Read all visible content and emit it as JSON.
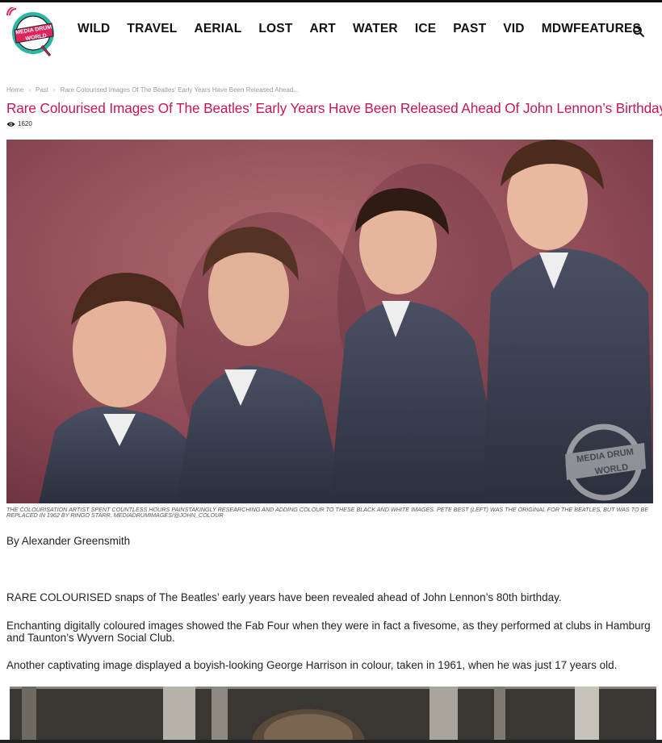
{
  "site": {
    "logo_text_line1": "MEDIA DRUM",
    "logo_text_line2": "WORLD",
    "nav": [
      "WILD",
      "TRAVEL",
      "AERIAL",
      "LOST",
      "ART",
      "WATER",
      "ICE",
      "PAST",
      "VID",
      "MDWFEATURES"
    ],
    "search_icon": "search-icon"
  },
  "breadcrumb": {
    "home": "Home",
    "section": "Past",
    "current": "Rare Colourised Images Of The Beatles' Early Years Have Been Released Ahead..."
  },
  "article": {
    "title": "Rare Colourised Images Of The Beatles’ Early Years Have Been Released Ahead Of John Lennon’s Birthday",
    "views": "1620",
    "caption": "THE COLOURISATION ARTIST SPENT COUNTLESS HOURS PAINSTAKINGLY RESEARCHING AND ADDING COLOUR TO THESE BLACK AND WHITE IMAGES. PETE BEST (LEFT) WAS THE ORIGINAL FOR THE BEATLES, BUT WAS TO BE REPLACED IN 1962 BY RINGO STARR. MEDIADRUMIMAGES/@JOHN_COLOUR",
    "watermark_line1": "MEDIA DRUM",
    "watermark_line2": "WORLD",
    "byline": "By Alexander Greensmith",
    "paragraphs": [
      "RARE COLOURISED snaps of The Beatles’ early years have been revealed ahead of John Lennon’s 80th birthday.",
      "Enchanting digitally coloured images showed the Fab Four when they were in fact a fivesome, as they performed at clubs in Hamburg and Taunton’s Wyvern Social Club.",
      "Another captivating image displayed a boyish-looking George Harrison in colour, taken in 1961, when he was just 17 years old."
    ]
  },
  "colors": {
    "accent": "#c2185b",
    "logo_teal": "#2bb5a4",
    "logo_pink": "#e0245e"
  }
}
